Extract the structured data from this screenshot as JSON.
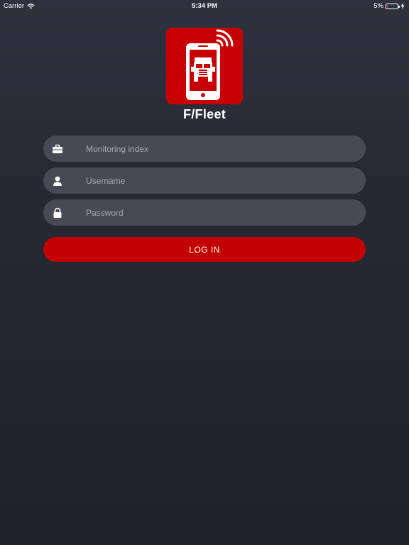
{
  "status_bar": {
    "carrier": "Carrier",
    "time": "5:34 PM",
    "battery_percent": "5%",
    "battery_level": 0.05
  },
  "app": {
    "name": "F/Fleet",
    "brand_color": "#c60000"
  },
  "form": {
    "monitoring_index": {
      "placeholder": "Monitoring index",
      "value": "",
      "icon": "briefcase-icon"
    },
    "username": {
      "placeholder": "Username",
      "value": "",
      "icon": "user-icon"
    },
    "password": {
      "placeholder": "Password",
      "value": "",
      "icon": "lock-icon"
    },
    "login_label": "LOG IN"
  },
  "colors": {
    "background_top": "#2e323e",
    "background_bottom": "#1f212a",
    "field_background": "#464a55",
    "button_background": "#c20000",
    "placeholder_text": "#a5a8b0"
  }
}
